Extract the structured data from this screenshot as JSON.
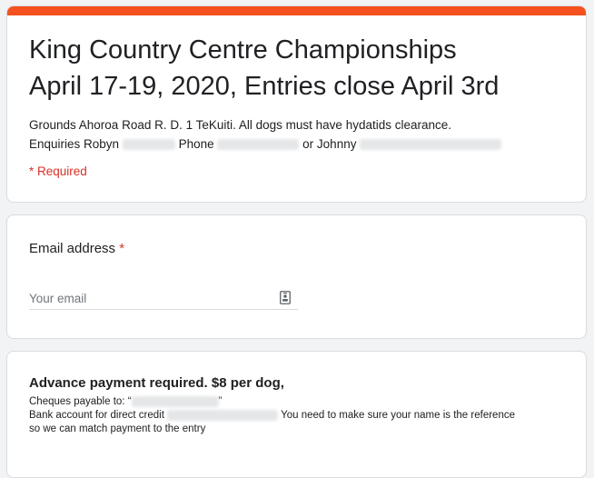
{
  "header": {
    "accent_color": "#f4511e",
    "title_line1": "King Country Centre Championships",
    "title_line2": "April 17-19, 2020, Entries close April 3rd",
    "desc_line1": "Grounds  Ahoroa Road  R. D. 1 TeKuiti.   All dogs must have hydatids clearance.",
    "desc_enquiries": "Enquiries Robyn",
    "desc_phone": "Phone",
    "desc_or": "or Johnny",
    "required_note": "* Required"
  },
  "email_question": {
    "label": "Email address",
    "required_mark": "*",
    "placeholder": "Your email",
    "value": "",
    "icon": "contact-card-icon"
  },
  "payment": {
    "title": "Advance payment required. $8 per dog,",
    "cheques_label": "Cheques payable to: “",
    "cheques_end": "”",
    "bank_label": "Bank account for direct credit",
    "bank_note": "You need to make sure your name is the reference",
    "bank_note2": "so we can match payment to the entry"
  }
}
